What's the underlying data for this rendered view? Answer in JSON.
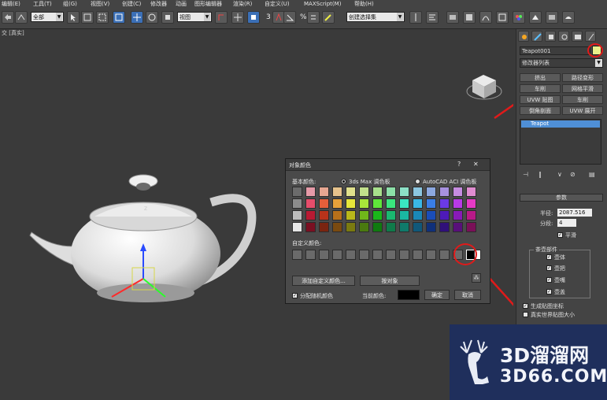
{
  "menu": [
    "编辑(E)",
    "工具(T)",
    "组(G)",
    "视图(V)",
    "创建(C)",
    "修改器",
    "动画",
    "图形编辑器",
    "渲染(R)",
    "自定义(U)",
    "MAXScript(M)",
    "帮助(H)"
  ],
  "toolbar": {
    "selection_filter": "全部",
    "ref_coord": "视图",
    "named_selection": "创建选择集",
    "snap_labels": [
      "3",
      "%"
    ]
  },
  "viewport": {
    "label_prefix": "交",
    "label_shading": "[真实]",
    "gizmo_axis_label": "Z"
  },
  "command_panel": {
    "object_name": "Teapot001",
    "object_color": "#e9f08a",
    "modifier_list": "修改器列表",
    "modifier_buttons": [
      "挤出",
      "路径变形",
      "车削",
      "网格平滑",
      "UVW 贴图",
      "车削",
      "倒角剖面",
      "UVW 展开"
    ],
    "stack_item": "Teapot",
    "params_title": "参数",
    "radius_label": "半径:",
    "radius_value": "2087.516",
    "segments_label": "分段:",
    "segments_value": "4",
    "smooth_label": "平滑",
    "parts_title": "茶壶部件",
    "parts": [
      "壶体",
      "壶把",
      "壶嘴",
      "壶盖"
    ],
    "gen_mapping_label": "生成贴图坐标",
    "real_world_label": "真实世界贴图大小"
  },
  "dialog": {
    "title": "对象颜色",
    "help": "?",
    "close": "✕",
    "basic_colors_label": "基本颜色:",
    "palette_max": "3ds Max 调色板",
    "palette_acad": "AutoCAD ACI 调色板",
    "custom_colors_label": "自定义颜色:",
    "add_custom_button": "添加自定义颜色...",
    "by_object_button": "按对象",
    "random_colors_label": "分配随机颜色",
    "current_color_label": "当前颜色:",
    "current_color": "#000000",
    "ok_button": "确定",
    "cancel_button": "取消",
    "swatches": [
      [
        "#6b6b6b",
        "#e69aa8",
        "#e6a691",
        "#e6c28c",
        "#e0e08c",
        "#c2e08c",
        "#a8e08c",
        "#8ce0a8",
        "#8ce0c6",
        "#8cc6e0",
        "#8ca8e0",
        "#a891e0",
        "#c68ce0",
        "#e08cd0"
      ],
      [
        "#8c8c8c",
        "#e64d6b",
        "#e65f3a",
        "#e6a13a",
        "#e6e63a",
        "#a8e63a",
        "#5fe63a",
        "#3ae67e",
        "#3ae6c2",
        "#3ab8e6",
        "#3a7ee6",
        "#6b3ae6",
        "#b83ae6",
        "#e63ac6"
      ],
      [
        "#bcbcbc",
        "#b81a33",
        "#b8331a",
        "#b8701a",
        "#b8b81a",
        "#70b81a",
        "#1ab81a",
        "#1ab870",
        "#1ab8a1",
        "#1a88b8",
        "#1a4db8",
        "#4d1ab8",
        "#881ab8",
        "#b81a88"
      ],
      [
        "#e6e6e6",
        "#7a1022",
        "#7a2410",
        "#7a4a10",
        "#7a7a10",
        "#4a7a10",
        "#107a10",
        "#107a4a",
        "#107a6a",
        "#10587a",
        "#10307a",
        "#30107a",
        "#58107a",
        "#7a1058"
      ]
    ],
    "custom_swatches": [
      "#6a6a6a",
      "#6a6a6a",
      "#6a6a6a",
      "#6a6a6a",
      "#6a6a6a",
      "#6a6a6a",
      "#6a6a6a",
      "#6a6a6a",
      "#6a6a6a",
      "#6a6a6a",
      "#6a6a6a",
      "#6a6a6a",
      "#6a6a6a",
      "#000000"
    ],
    "selected_custom": "#000000",
    "selected_border_color": "#ffffff"
  },
  "annotation_color": "#e01a1a",
  "watermark": {
    "brand_cn": "3D溜溜网",
    "brand_en": "3D66.COM",
    "bg": "#1f2f5c"
  }
}
